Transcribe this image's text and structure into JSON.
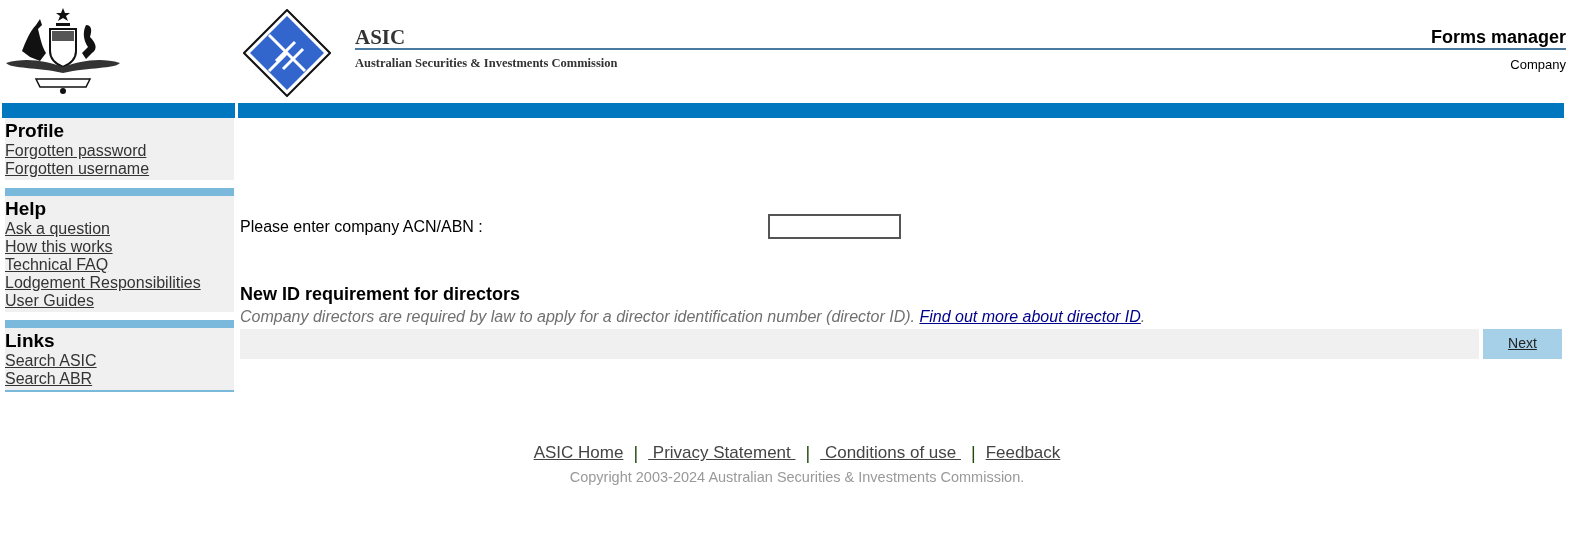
{
  "header": {
    "title": "ASIC",
    "subtitle": "Australian Securities & Investments Commission",
    "app_title": "Forms manager",
    "app_subtitle": "Company"
  },
  "sidebar": [
    {
      "heading": "Profile",
      "links": [
        "Forgotten password",
        "Forgotten username"
      ]
    },
    {
      "heading": "Help",
      "links": [
        "Ask a question",
        "How this works",
        "Technical FAQ",
        "Lodgement Responsibilities",
        "User Guides"
      ]
    },
    {
      "heading": "Links",
      "links": [
        "Search ASIC",
        "Search ABR"
      ]
    }
  ],
  "form": {
    "label": "Please enter company ACN/ABN :"
  },
  "notice": {
    "heading": "New ID requirement for directors",
    "text": "Company directors are required by law to apply for a director identification number (director ID). ",
    "link": "Find out more about director ID",
    "after": "."
  },
  "next_button": "Next",
  "footer": {
    "items": [
      {
        "kind": "link",
        "text": "ASIC Home"
      },
      {
        "kind": "separator",
        "text": "|"
      },
      {
        "kind": "link",
        "text": " Privacy Statement "
      },
      {
        "kind": "separator",
        "text": "|"
      },
      {
        "kind": "link",
        "text": " Conditions of use "
      },
      {
        "kind": "separator",
        "text": "|"
      },
      {
        "kind": "link",
        "text": "Feedback"
      }
    ],
    "copyright": "Copyright 2003-2024 Australian Securities & Investments Commission."
  }
}
